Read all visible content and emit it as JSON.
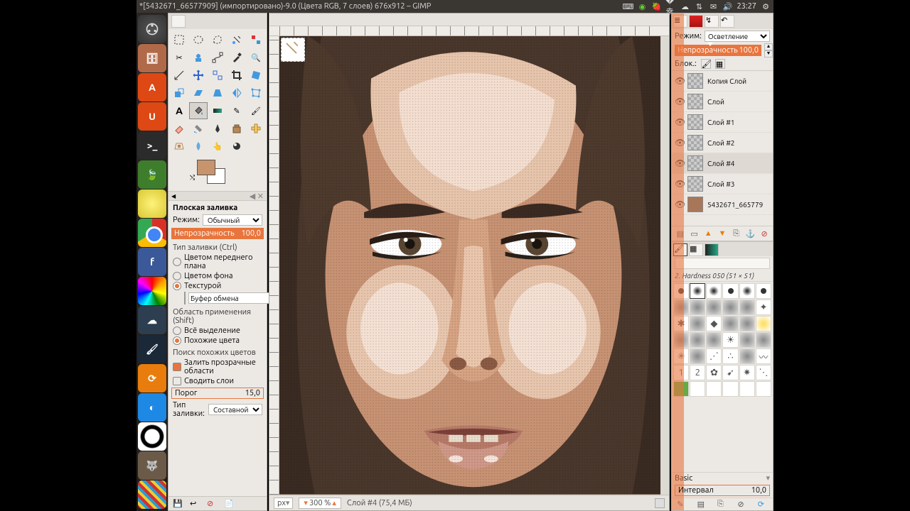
{
  "top_panel": {
    "title": "*[5432671_66577909] (импортировано)-9.0 (Цвета RGB, 7 слоев) 676x912 – GIMP",
    "clock": "23:27"
  },
  "toolbox": {
    "option_title": "Плоская заливка",
    "mode_label": "Режим:",
    "mode_value": "Обычный",
    "opacity_label": "Непрозрачность",
    "opacity_value": "100,0",
    "fill_type_label": "Тип заливки (Ctrl)",
    "fill_fg": "Цветом переднего плана",
    "fill_bg": "Цветом фона",
    "fill_pattern": "Текстурой",
    "pattern_name": "Буфер обмена",
    "area_label": "Область применения (Shift)",
    "area_all": "Всё выделение",
    "area_similar": "Похожие цвета",
    "similar_label": "Поиск похожих цветов",
    "transparent_check": "Залить прозрачные области",
    "merged_check": "Сводить слои",
    "threshold_label": "Порог",
    "threshold_value": "15,0",
    "fillby_label": "Тип заливки:",
    "fillby_value": "Составной"
  },
  "canvas": {
    "unit": "px",
    "zoom": "300 %",
    "status": "Слой #4 (75,4 МБ)"
  },
  "layers_dock": {
    "mode_label": "Режим:",
    "mode_value": "Осветление",
    "opacity_label": "Непрозрачность",
    "opacity_value": "100,0",
    "lock_label": "Блок.:",
    "layers": [
      {
        "name": "Копия Слой",
        "visible": true,
        "img": false
      },
      {
        "name": "Слой",
        "visible": true,
        "img": false
      },
      {
        "name": "Слой #1",
        "visible": true,
        "img": false
      },
      {
        "name": "Слой #2",
        "visible": true,
        "img": false
      },
      {
        "name": "Слой #4",
        "visible": true,
        "img": false,
        "selected": true
      },
      {
        "name": "Слой #3",
        "visible": true,
        "img": false
      },
      {
        "name": "5432671_665779",
        "visible": true,
        "img": true
      }
    ]
  },
  "brushes": {
    "info": "2. Hardness 050 (51 × 51)",
    "category": "Basic",
    "spacing_label": "Интервал",
    "spacing_value": "10,0"
  }
}
